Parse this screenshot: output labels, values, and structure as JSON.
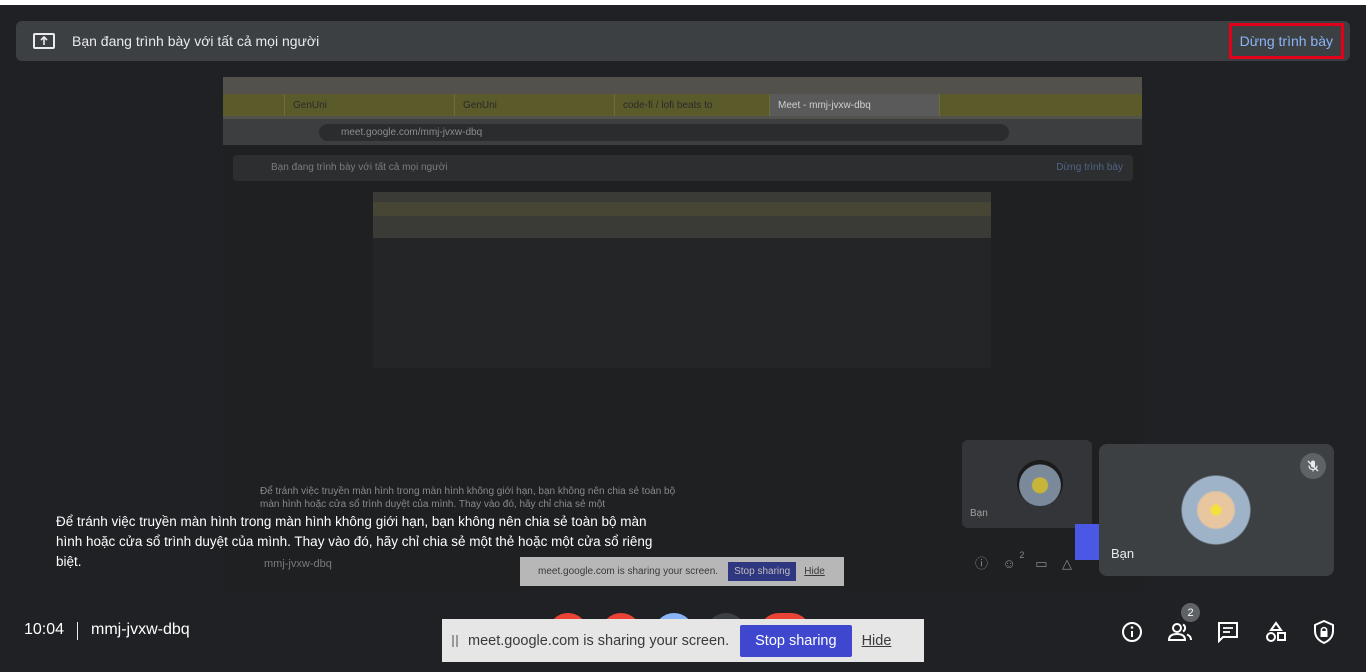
{
  "presentation_bar": {
    "message": "Bạn đang trình bày với tất cả mọi người",
    "stop_button": "Dừng trình bày",
    "icon": "present-to-all-icon"
  },
  "shared_preview": {
    "tabs": [
      "GenUni",
      "GenUni",
      "code-fi / lofi beats to",
      "Meet - mmj-jvxw-dbq"
    ],
    "url": "meet.google.com/mmj-jvxw-dbq",
    "present_message": "Bạn đang trình bày với tất cả mọi người",
    "present_stop": "Dừng trình bày",
    "caption": "Để tránh việc truyền màn hình trong màn hình không giới hạn, bạn không nên chia sẻ toàn bộ màn hình hoặc cửa sổ trình duyệt của mình. Thay vào đó, hãy chỉ chia sẻ một",
    "meeting_code": "mmj-jvxw-dbq",
    "self_name": "Bạn",
    "share_text": "meet.google.com is sharing your screen.",
    "share_stop": "Stop sharing",
    "share_hide": "Hide",
    "badge": "2"
  },
  "self_tile": {
    "name": "Bạn",
    "mic_icon": "mic-off-icon"
  },
  "caption": {
    "text": "Để tránh việc truyền màn hình trong màn hình không giới hạn, bạn không nên chia sẻ toàn bộ màn hình hoặc cửa sổ trình duyệt của mình. Thay vào đó, hãy chỉ chia sẻ một thẻ hoặc một cửa sổ riêng biệt."
  },
  "bottom_bar": {
    "time": "10:04",
    "meeting_code": "mmj-jvxw-dbq",
    "participants_count": "2",
    "icons": [
      "info-icon",
      "people-icon",
      "chat-icon",
      "activities-icon",
      "host-controls-icon"
    ]
  },
  "share_notice": {
    "text": "meet.google.com is sharing your screen.",
    "stop_button": "Stop sharing",
    "hide_link": "Hide"
  },
  "colors": {
    "background": "#202124",
    "bar": "#3c4043",
    "link_blue": "#8ab4f8",
    "highlight_red": "#e3001b",
    "stop_sharing_blue": "#3f47cf"
  }
}
